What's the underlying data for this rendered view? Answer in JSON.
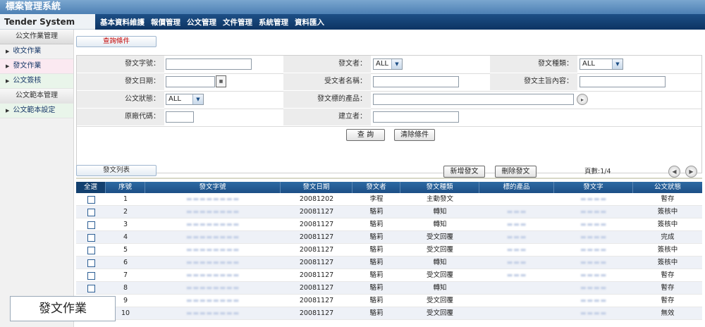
{
  "window": {
    "title": "標案管理系統",
    "brand": "Tender System"
  },
  "menu": [
    "基本資料維護",
    "報價管理",
    "公文管理",
    "文件管理",
    "系統管理",
    "資料匯入"
  ],
  "sidebar": {
    "header": "公文作業管理",
    "items": [
      {
        "label": "收文作業",
        "arrow": true
      },
      {
        "label": "發文作業",
        "arrow": true,
        "active": true
      },
      {
        "label": "公文簽核",
        "arrow": true
      },
      {
        "label": "公文範本管理",
        "arrow": false
      },
      {
        "label": "公文範本設定",
        "arrow": true
      }
    ]
  },
  "query": {
    "tab": "查詢條件",
    "fields": {
      "doc_no": "發文字號：",
      "sender": "發文者：",
      "doc_type": "發文種類：",
      "send_date": "發文日期：",
      "receiver": "受文者名稱：",
      "subject": "發文主旨內容：",
      "status": "公文狀態：",
      "product": "發文標的產品：",
      "vendor_code": "原廠代碼：",
      "creator": "建立者："
    },
    "select_value": "ALL",
    "search_btn": "查 詢",
    "clear_btn": "清除條件"
  },
  "list": {
    "tab": "發文列表",
    "add_btn": "新增發文",
    "delete_btn": "刪除發文",
    "pages": "頁數:1/4",
    "columns": [
      "全選",
      "序號",
      "發文字號",
      "發文日期",
      "發文者",
      "發文種類",
      "標的產品",
      "發文字",
      "公文狀態"
    ],
    "rows": [
      {
        "no": "1",
        "date": "20081202",
        "sender": "李程",
        "type": "主動發文",
        "status": "暫存"
      },
      {
        "no": "2",
        "date": "20081127",
        "sender": "駱莉",
        "type": "轉知",
        "status": "簽核中"
      },
      {
        "no": "3",
        "date": "20081127",
        "sender": "駱莉",
        "type": "轉知",
        "status": "簽核中"
      },
      {
        "no": "4",
        "date": "20081127",
        "sender": "駱莉",
        "type": "受文回覆",
        "status": "完成"
      },
      {
        "no": "5",
        "date": "20081127",
        "sender": "駱莉",
        "type": "受文回覆",
        "status": "簽核中"
      },
      {
        "no": "6",
        "date": "20081127",
        "sender": "駱莉",
        "type": "轉知",
        "status": "簽核中"
      },
      {
        "no": "7",
        "date": "20081127",
        "sender": "駱莉",
        "type": "受文回覆",
        "status": "暫存"
      },
      {
        "no": "8",
        "date": "20081127",
        "sender": "駱莉",
        "type": "轉知",
        "status": "暫存"
      },
      {
        "no": "9",
        "date": "20081127",
        "sender": "駱莉",
        "type": "受文回覆",
        "status": "暫存"
      },
      {
        "no": "10",
        "date": "20081127",
        "sender": "駱莉",
        "type": "受文回覆",
        "status": "無效"
      }
    ]
  },
  "caption": "發文作業"
}
